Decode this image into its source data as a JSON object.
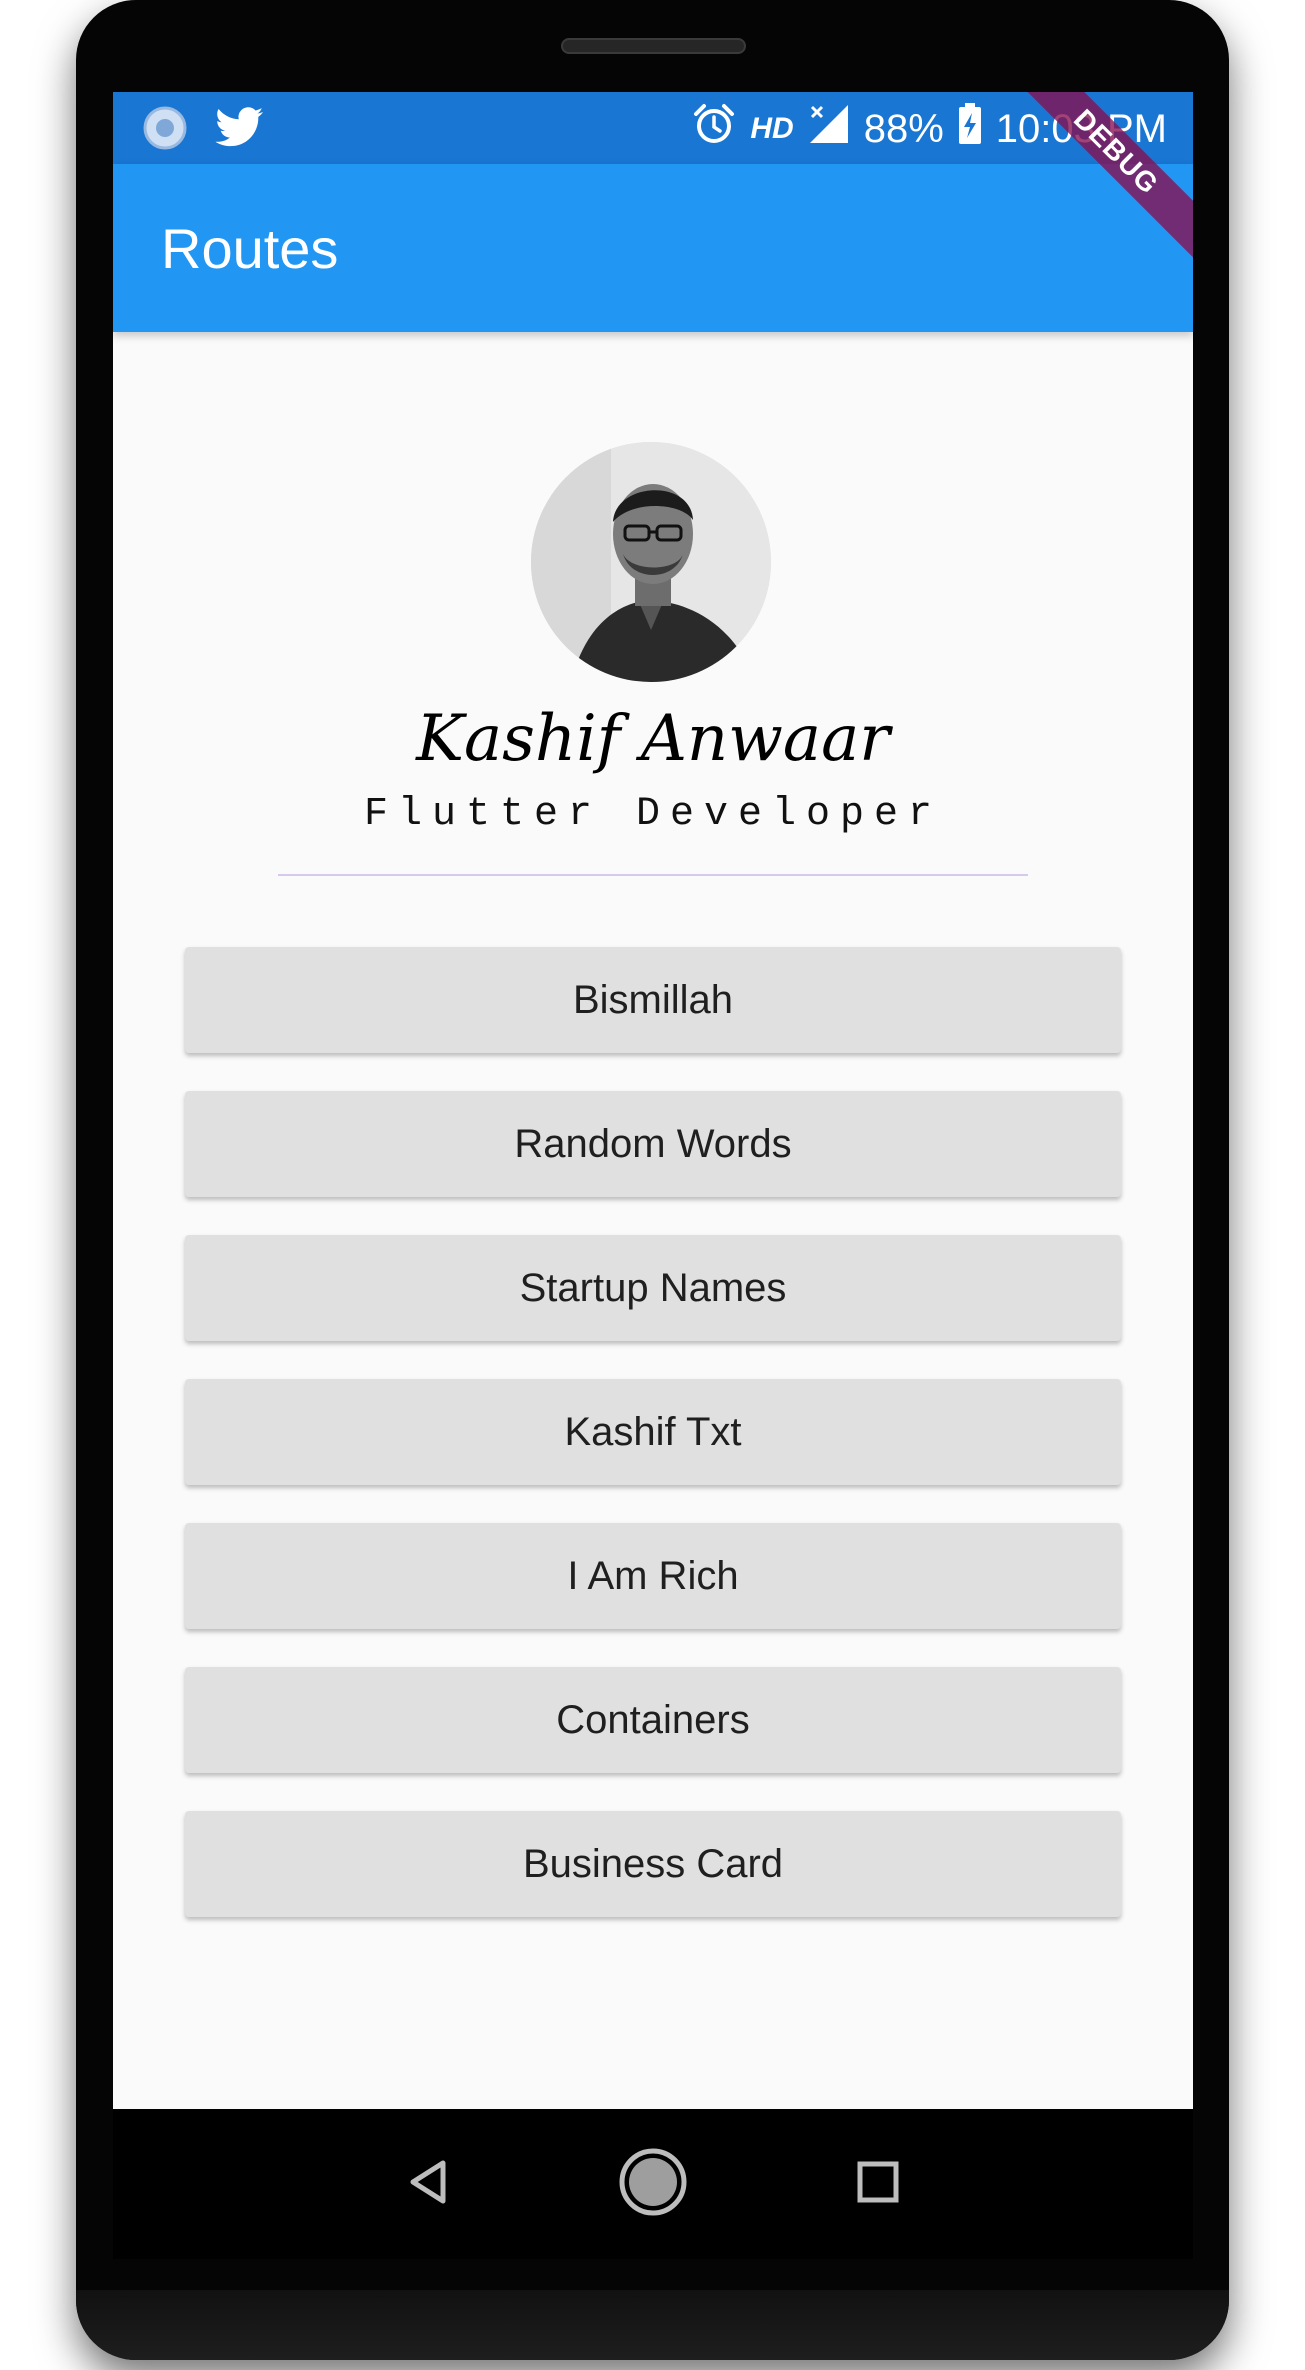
{
  "status_bar": {
    "left_icons": [
      "chromium-icon",
      "twitter-icon"
    ],
    "network": "HD",
    "battery": "88%",
    "time": "10:03 PM"
  },
  "app_bar": {
    "title": "Routes",
    "debug_banner": "DEBUG",
    "color": "#2196f3"
  },
  "profile": {
    "name": "Kashif Anwaar",
    "role": "Flutter Developer"
  },
  "menu": {
    "buttons": [
      {
        "label": "Bismillah"
      },
      {
        "label": "Random Words"
      },
      {
        "label": "Startup Names"
      },
      {
        "label": "Kashif Txt"
      },
      {
        "label": "I Am Rich"
      },
      {
        "label": "Containers"
      },
      {
        "label": "Business Card"
      }
    ]
  },
  "navigation": {
    "buttons": [
      "back-icon",
      "home-icon",
      "recents-icon"
    ]
  }
}
